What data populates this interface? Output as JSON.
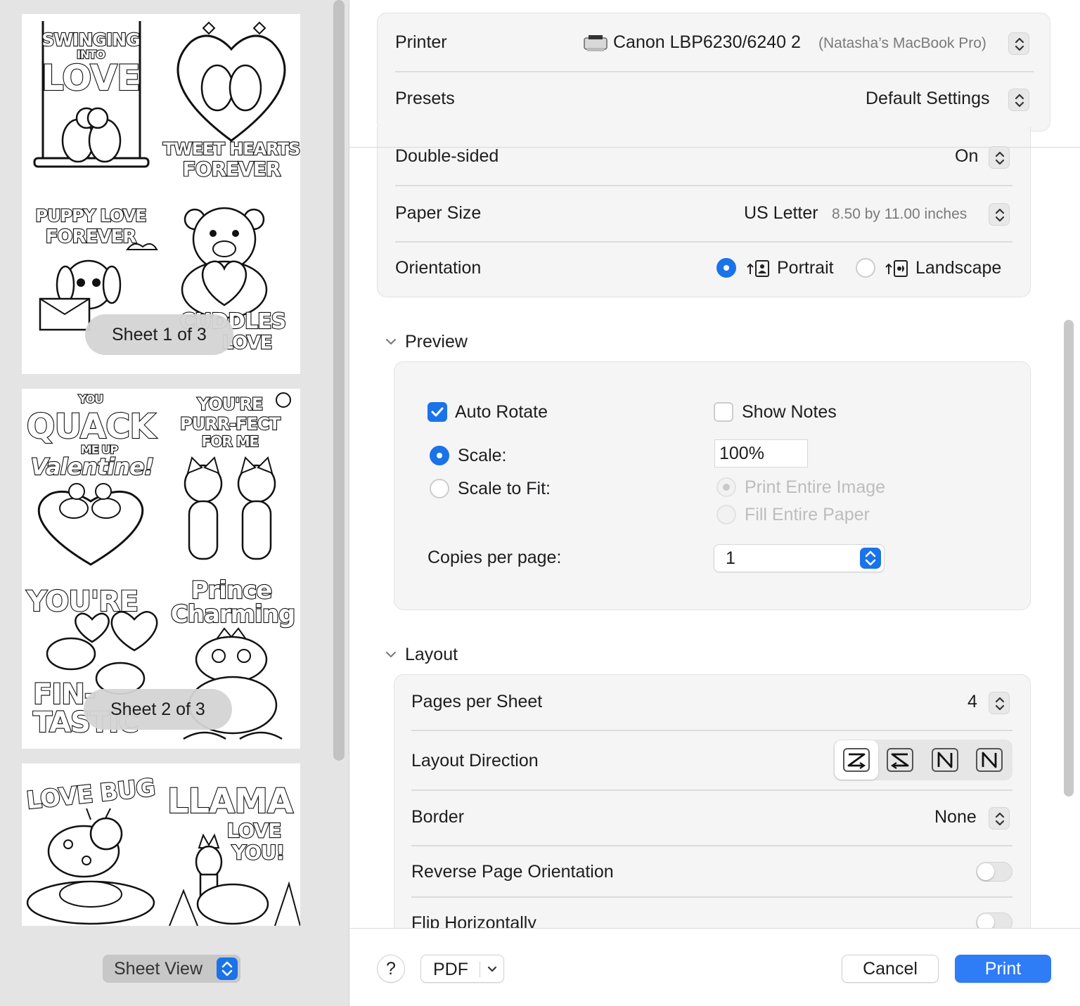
{
  "sidebar": {
    "sheets": [
      {
        "badge": "Sheet 1 of 3",
        "cells": [
          "SWINGING",
          "INTO",
          "LOVE",
          "TWEET HEARTS",
          "FOREVER",
          "PUPPY LOVE",
          "FOREVER",
          "CUDDLES",
          "LOVE"
        ]
      },
      {
        "badge": "Sheet 2 of 3",
        "cells": [
          "YOU",
          "QUACK",
          "ME UP",
          "Valentine!",
          "YOU'RE",
          "PURR-FECT",
          "FOR ME",
          "YOU'RE",
          "FIN-",
          "TASTIC",
          "Prince",
          "Charming"
        ]
      },
      {
        "cells": [
          "LOVE BUG",
          "LLAMA",
          "LOVE",
          "YOU!"
        ]
      }
    ],
    "view_selector": "Sheet View"
  },
  "printer": {
    "label": "Printer",
    "name": "Canon LBP6230/6240 2",
    "host": "(Natasha’s MacBook Pro)"
  },
  "presets": {
    "label": "Presets",
    "value": "Default Settings"
  },
  "double_sided": {
    "label": "Double-sided",
    "value": "On"
  },
  "paper_size": {
    "label": "Paper Size",
    "value": "US Letter",
    "detail": "8.50 by 11.00 inches"
  },
  "orientation": {
    "label": "Orientation",
    "portrait": "Portrait",
    "landscape": "Landscape",
    "selected": "portrait"
  },
  "preview": {
    "title": "Preview",
    "auto_rotate": "Auto Rotate",
    "show_notes": "Show Notes",
    "scale": "Scale:",
    "scale_value": "100%",
    "scale_to_fit": "Scale to Fit:",
    "print_entire_image": "Print Entire Image",
    "fill_entire_paper": "Fill Entire Paper",
    "copies_per_page": "Copies per page:",
    "copies_value": "1"
  },
  "layout": {
    "title": "Layout",
    "pages_per_sheet": "Pages per Sheet",
    "pages_per_sheet_value": "4",
    "layout_direction": "Layout Direction",
    "border": "Border",
    "border_value": "None",
    "reverse_page_orientation": "Reverse Page Orientation",
    "flip_horizontally": "Flip Horizontally"
  },
  "footer": {
    "help": "?",
    "pdf": "PDF",
    "cancel": "Cancel",
    "print": "Print"
  },
  "colors": {
    "accent": "#1a73e8",
    "primary_button": "#2e7cf6",
    "sidebar_bg": "#e4e4e4"
  }
}
